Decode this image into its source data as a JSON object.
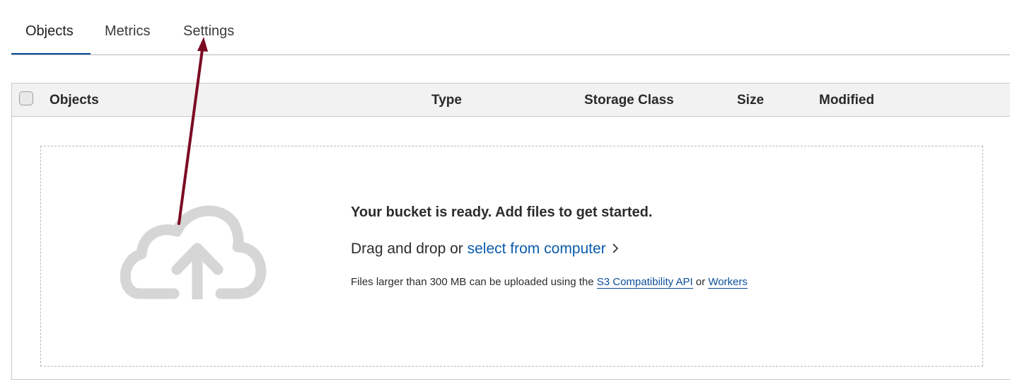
{
  "tabs": {
    "objects": "Objects",
    "metrics": "Metrics",
    "settings": "Settings"
  },
  "table": {
    "columns": {
      "objects": "Objects",
      "type": "Type",
      "storage_class": "Storage Class",
      "size": "Size",
      "modified": "Modified"
    }
  },
  "empty_state": {
    "title": "Your bucket is ready. Add files to get started.",
    "drag_text": "Drag and drop or ",
    "select_link": "select from computer",
    "note_prefix": "Files larger than 300 MB can be uploaded using the ",
    "s3_link": "S3 Compatibility API",
    "note_or": " or ",
    "workers_link": "Workers"
  },
  "icons": {
    "cloud": "cloud-upload-icon",
    "chevron": "chevron-right-icon",
    "checkbox": "select-all-checkbox"
  },
  "colors": {
    "active_tab_underline": "#0a4e9b",
    "link": "#0b5cad",
    "arrow": "#7b0a23",
    "cloud": "#d6d6d6"
  }
}
